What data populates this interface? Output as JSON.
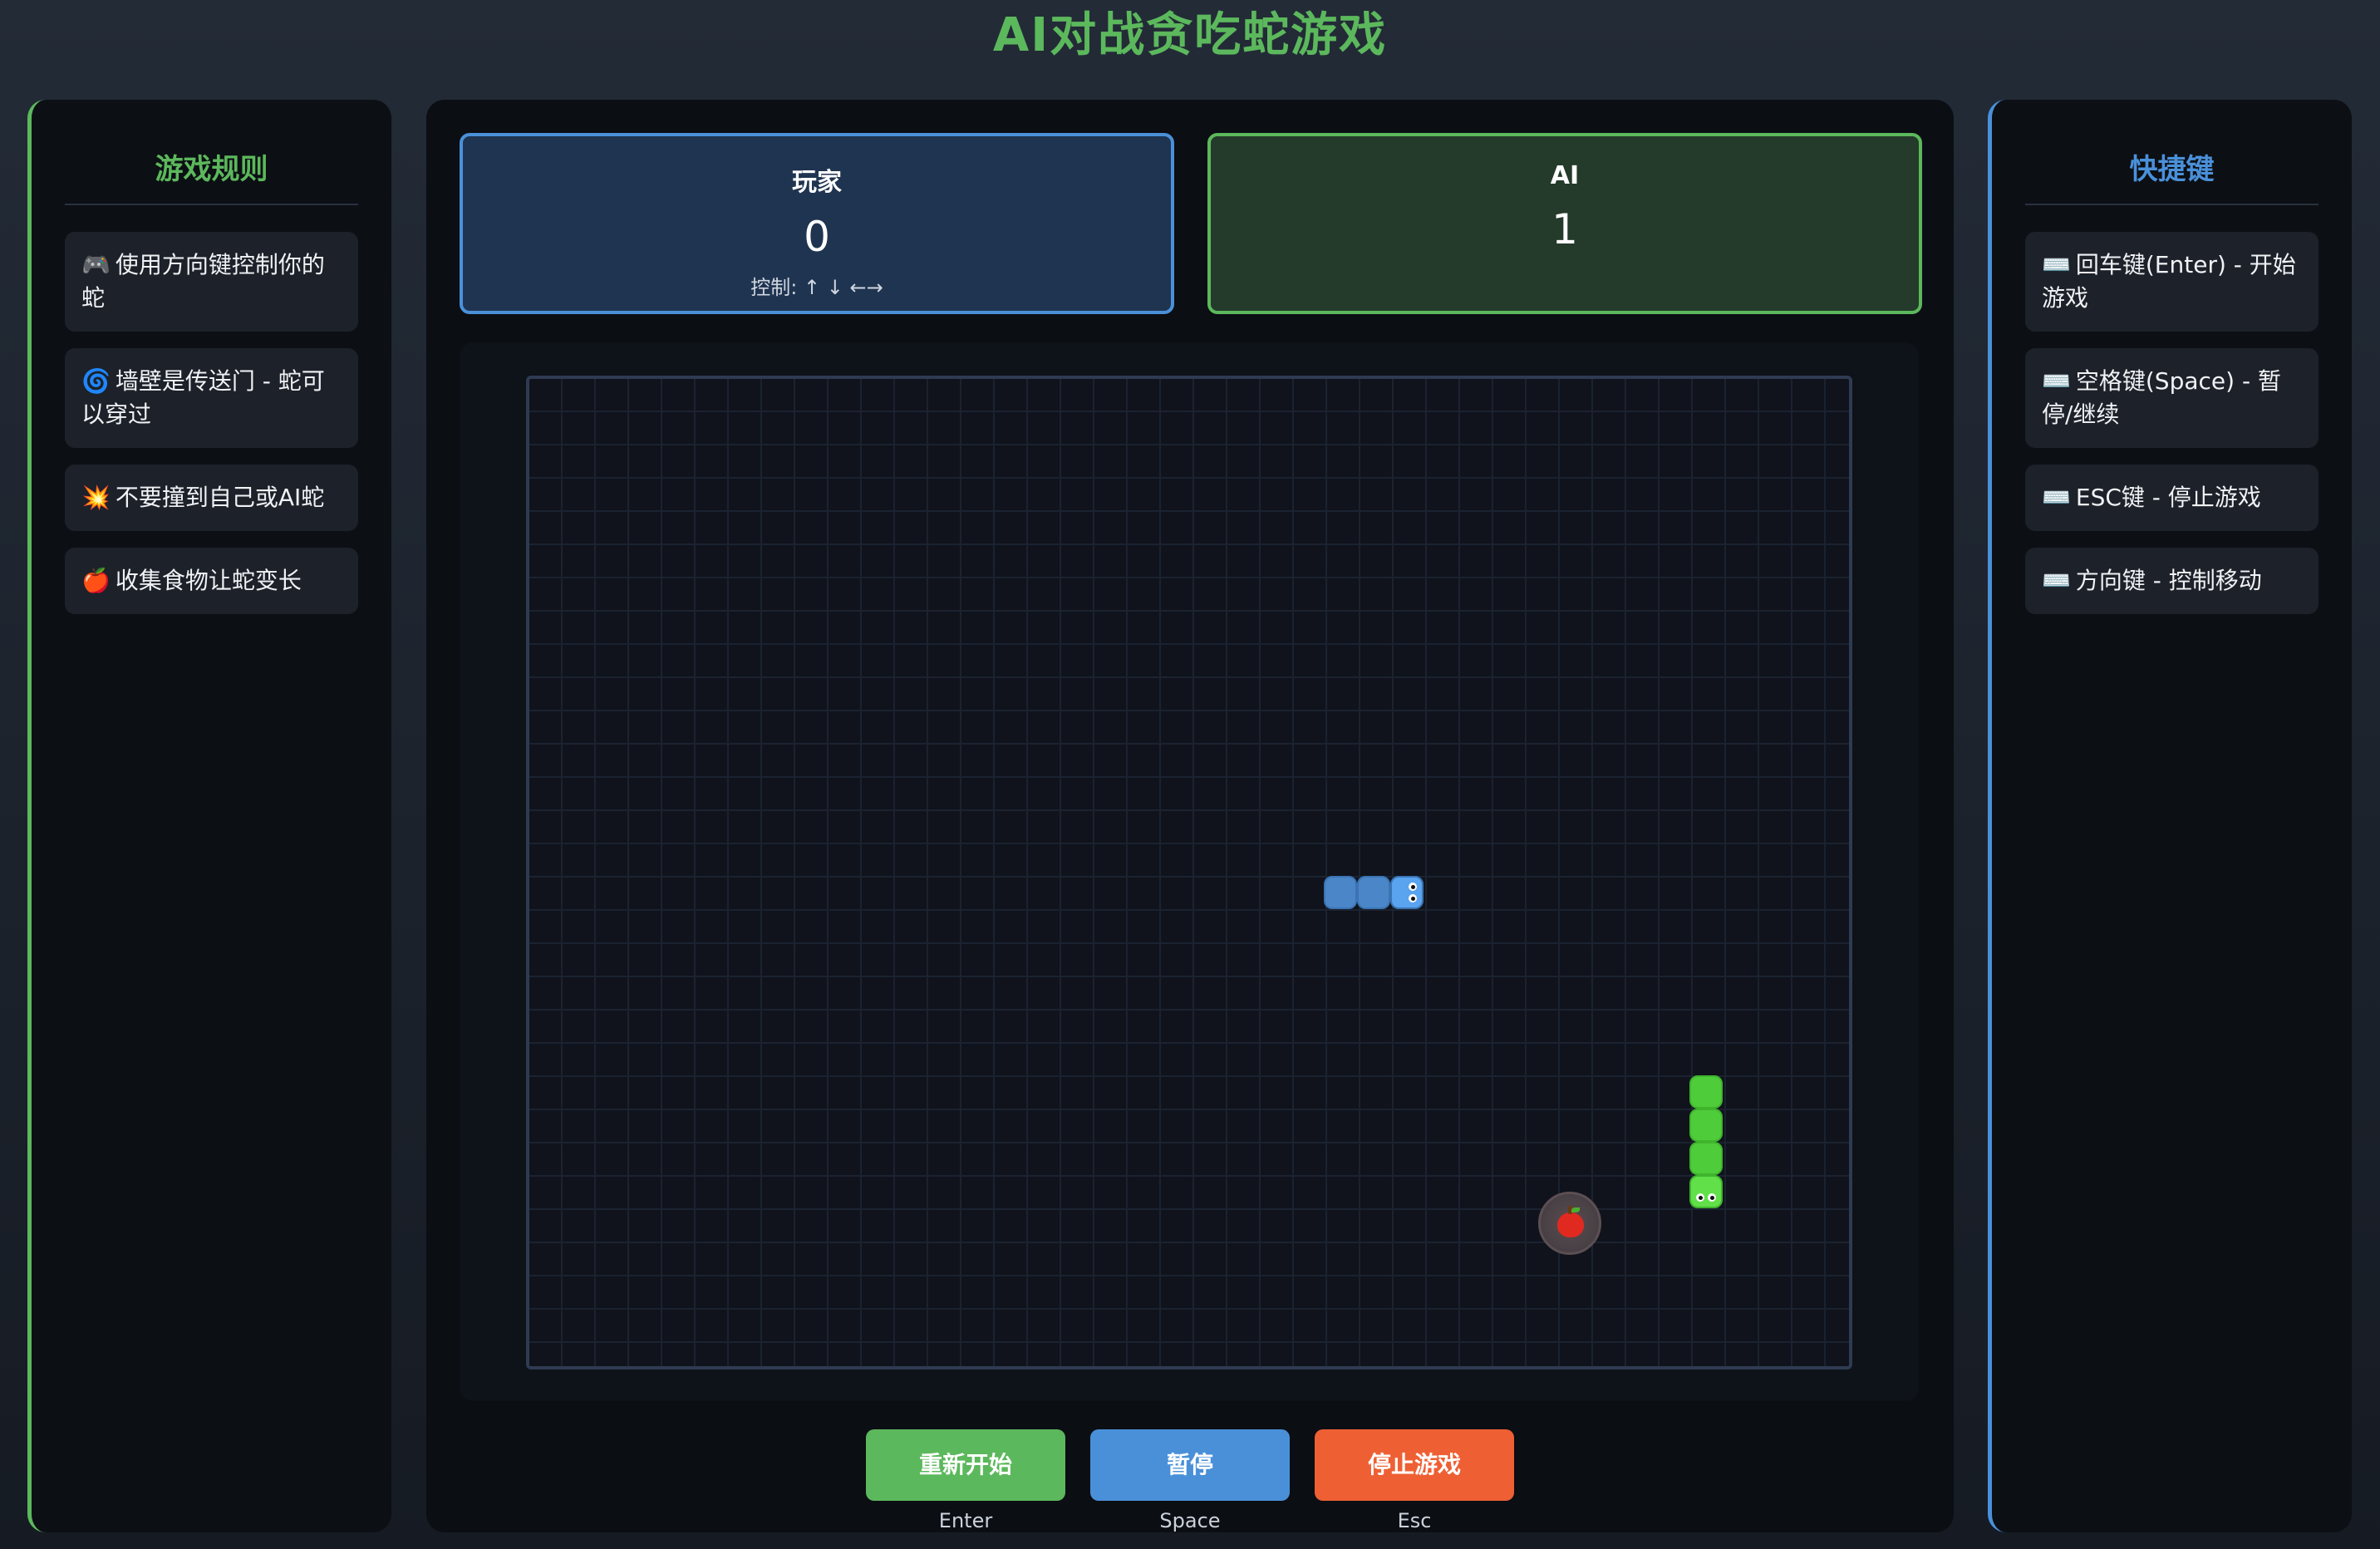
{
  "title": "AI对战贪吃蛇游戏",
  "rules": {
    "heading": "游戏规则",
    "items": [
      {
        "icon": "🎮",
        "text": "使用方向键控制你的蛇"
      },
      {
        "icon": "🌀",
        "text": "墙壁是传送门 - 蛇可以穿过"
      },
      {
        "icon": "💥",
        "text": "不要撞到自己或AI蛇"
      },
      {
        "icon": "🍎",
        "text": "收集食物让蛇变长"
      }
    ]
  },
  "shortcuts": {
    "heading": "快捷键",
    "items": [
      {
        "icon": "⌨️",
        "text": "回车键(Enter) - 开始游戏"
      },
      {
        "icon": "⌨️",
        "text": "空格键(Space) - 暂停/继续"
      },
      {
        "icon": "⌨️",
        "text": "ESC键 - 停止游戏"
      },
      {
        "icon": "⌨️",
        "text": "方向键 - 控制移动"
      }
    ]
  },
  "scoreboard": {
    "player": {
      "name": "玩家",
      "score": "0",
      "controls": "控制: ↑ ↓ ←→"
    },
    "ai": {
      "name": "AI",
      "score": "1"
    }
  },
  "board": {
    "player_snake": {
      "color": "#4a86c8",
      "length": 3,
      "direction": "right"
    },
    "ai_snake": {
      "color": "#4fcc3a",
      "length": 4,
      "direction": "down"
    },
    "food": {
      "icon": "apple-icon"
    }
  },
  "controls": {
    "restart": {
      "label": "重新开始",
      "hint": "Enter",
      "color": "#5cb85c"
    },
    "pause": {
      "label": "暂停",
      "hint": "Space",
      "color": "#4a90d9"
    },
    "stop": {
      "label": "停止游戏",
      "hint": "Esc",
      "color": "#ee6034"
    }
  }
}
